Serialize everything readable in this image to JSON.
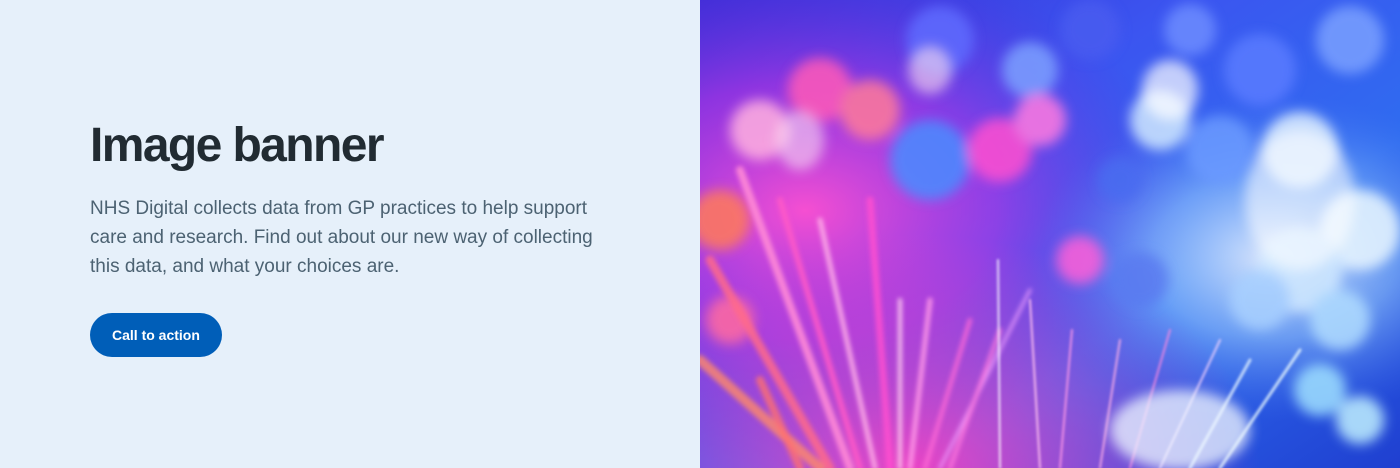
{
  "banner": {
    "title": "Image banner",
    "description": "NHS Digital collects data from GP practices to help support care and research. Find out about our new way of collecting this data, and what your choices are.",
    "cta_label": "Call to action",
    "image_subject": "fibre-optic-lights-abstract-photo"
  },
  "colors": {
    "content_background": "#e6f0fa",
    "title": "#212b32",
    "body_text": "#4c6272",
    "cta_background": "#005eb8",
    "cta_text": "#ffffff",
    "image_blue": "#2e3ce6",
    "image_magenta": "#e62ee0",
    "image_light": "#e6f6ff"
  }
}
